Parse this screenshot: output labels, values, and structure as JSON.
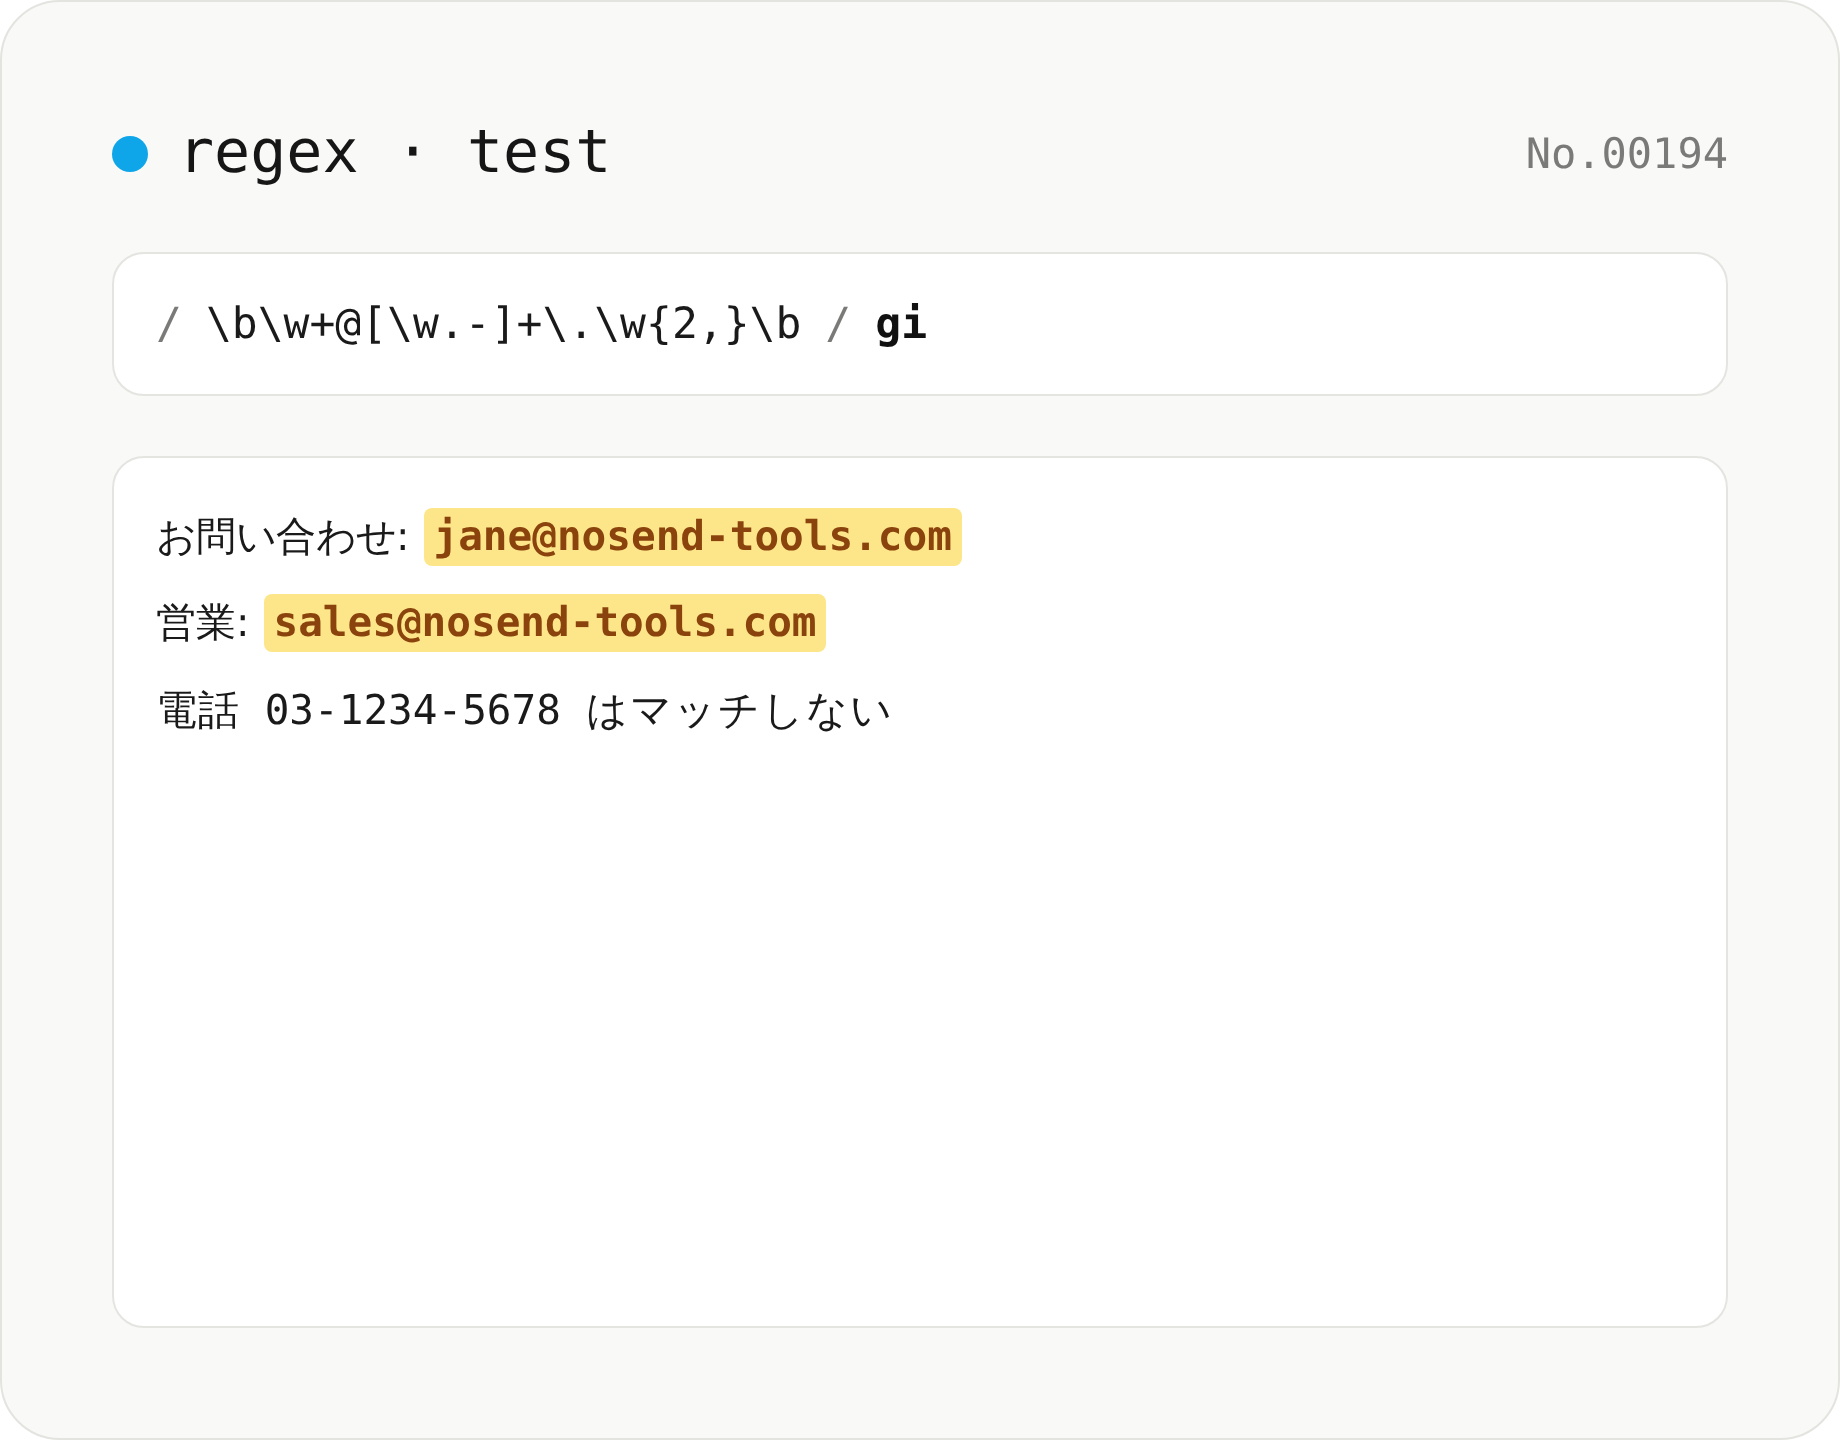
{
  "header": {
    "title": "regex · test",
    "number": "No.00194"
  },
  "pattern": {
    "open": "/",
    "source": "\\b\\w+@[\\w.-]+\\.\\w{2,}\\b",
    "close": "/",
    "flags": "gi"
  },
  "sample": {
    "lines": [
      {
        "segments": [
          {
            "kind": "label",
            "text": "お問い合わせ:"
          },
          {
            "kind": "match",
            "text": "jane@nosend-tools.com"
          }
        ]
      },
      {
        "segments": [
          {
            "kind": "label",
            "text": "営業:"
          },
          {
            "kind": "match",
            "text": "sales@nosend-tools.com"
          }
        ]
      },
      {
        "segments": [
          {
            "kind": "code",
            "text": "電話 03-1234-5678 はマッチしない"
          }
        ]
      }
    ]
  }
}
